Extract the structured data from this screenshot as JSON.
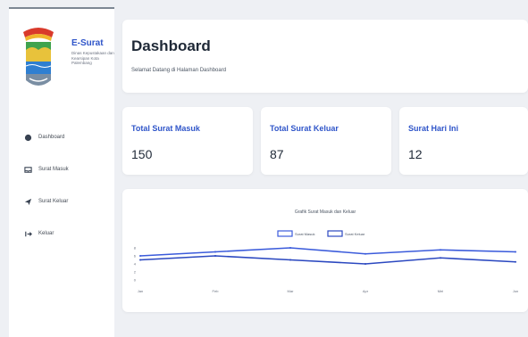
{
  "brand": {
    "title": "E-Surat",
    "subtitle": "Dinas Kepustakaan dan Kearsipan Kota Palembang"
  },
  "sidebar": {
    "items": [
      {
        "label": "Dashboard",
        "icon": "dashboard-icon"
      },
      {
        "label": "Surat Masuk",
        "icon": "inbox-icon"
      },
      {
        "label": "Surat Keluar",
        "icon": "send-icon"
      },
      {
        "label": "Keluar",
        "icon": "logout-icon"
      }
    ]
  },
  "header": {
    "title": "Dashboard",
    "subtitle": "Selamat Datang di Halaman Dashboard"
  },
  "stats": [
    {
      "label": "Total Surat Masuk",
      "value": "150"
    },
    {
      "label": "Total Surat Keluar",
      "value": "87"
    },
    {
      "label": "Surat Hari Ini",
      "value": "12"
    }
  ],
  "colors": {
    "accent": "#2f55c9",
    "series_masuk": "#3b5bdb",
    "series_keluar": "#2b48c0"
  },
  "chart_data": {
    "type": "line",
    "title": "Grafik Surat Masuk dan Keluar",
    "categories": [
      "Jan",
      "Feb",
      "Mar",
      "Apr",
      "Mei",
      "Jun"
    ],
    "series": [
      {
        "name": "Surat Masuk",
        "values": [
          6,
          7,
          8,
          6.5,
          7.5,
          7
        ]
      },
      {
        "name": "Surat Keluar",
        "values": [
          5,
          6,
          5,
          4,
          5.5,
          4.5
        ]
      }
    ],
    "yticks": [
      "8",
      "6",
      "4",
      "2",
      "0"
    ],
    "ylim": [
      0,
      8
    ],
    "legend": "top-center",
    "grid": false
  }
}
